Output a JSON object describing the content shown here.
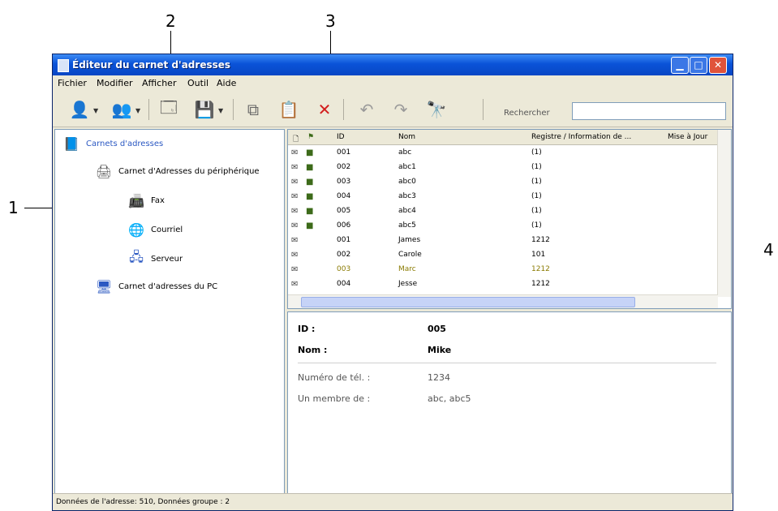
{
  "callouts": {
    "one": "1",
    "two": "2",
    "three": "3",
    "four": "4"
  },
  "window": {
    "title": "Éditeur du carnet d'adresses"
  },
  "menu": {
    "items": [
      "Fichier",
      "Modifier",
      "Afficher",
      "Outil",
      "Aide"
    ]
  },
  "toolbar": {
    "search_label": "Rechercher",
    "search_value": ""
  },
  "tree": {
    "root": "Carnets d'adresses",
    "device_book": "Carnet d'Adresses du périphérique",
    "fax": "Fax",
    "email": "Courriel",
    "server": "Serveur",
    "pc_book": "Carnet d'adresses du PC"
  },
  "list": {
    "headers": [
      "ID",
      "Nom",
      "Registre / Information de ...",
      "Mise à Jour"
    ],
    "rows": [
      {
        "id": "001",
        "name": "abc",
        "info": "(1)"
      },
      {
        "id": "002",
        "name": "abc1",
        "info": "(1)"
      },
      {
        "id": "003",
        "name": "abc0",
        "info": "(1)"
      },
      {
        "id": "004",
        "name": "abc3",
        "info": "(1)"
      },
      {
        "id": "005",
        "name": "abc4",
        "info": "(1)"
      },
      {
        "id": "006",
        "name": "abc5",
        "info": "(1)"
      },
      {
        "id": "001",
        "name": "James",
        "info": "1212"
      },
      {
        "id": "002",
        "name": "Carole",
        "info": "101"
      },
      {
        "id": "003",
        "name": "Marc",
        "info": "1212"
      },
      {
        "id": "004",
        "name": "Jesse",
        "info": "1212"
      }
    ]
  },
  "detail": {
    "id_label": "ID :",
    "id_value": "005",
    "name_label": "Nom :",
    "name_value": "Mike",
    "dial_label": "Numéro de tél. :",
    "dial_value": "1234",
    "member_label": "Un membre de :",
    "member_value": "abc, abc5"
  },
  "status": {
    "text": "Données de l'adresse: 510, Données groupe : 2"
  },
  "colors": {
    "title_blue": "#0a53d8",
    "close_red": "#e0533b",
    "delete_red": "#d21d1d",
    "window_bg": "#ece9d8"
  }
}
